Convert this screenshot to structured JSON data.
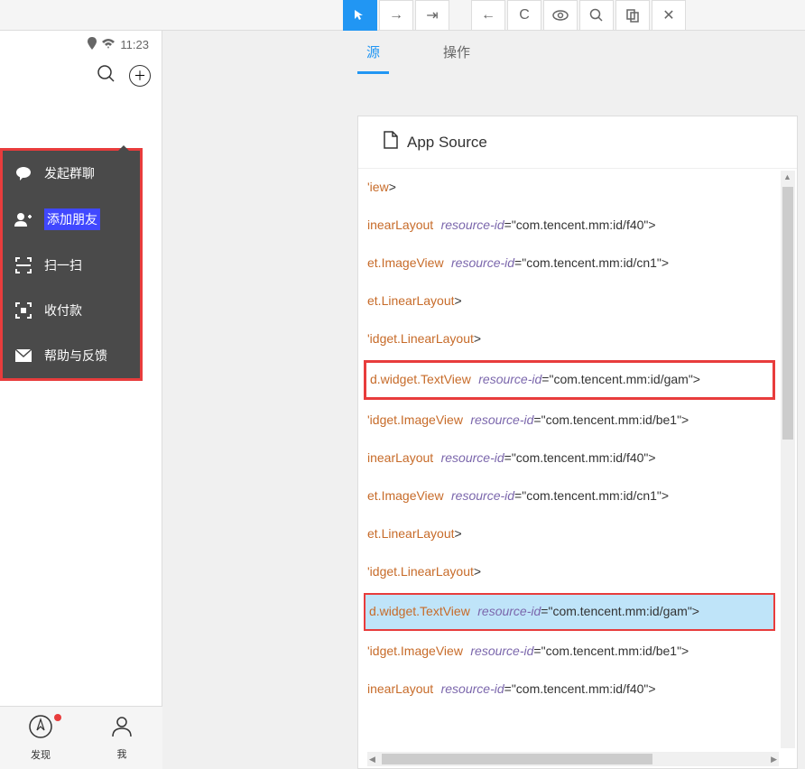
{
  "toolbar": {
    "buttons": [
      "select",
      "swipe-right",
      "swipe-out",
      "back",
      "refresh",
      "eye",
      "search",
      "copy",
      "close"
    ]
  },
  "statusBar": {
    "time": "11:23"
  },
  "dropdown": {
    "items": [
      {
        "icon": "speech",
        "label": "发起群聊"
      },
      {
        "icon": "add-friend",
        "label": "添加朋友",
        "highlighted": true
      },
      {
        "icon": "scan",
        "label": "扫一扫"
      },
      {
        "icon": "pay",
        "label": "收付款"
      },
      {
        "icon": "help",
        "label": "帮助与反馈"
      }
    ]
  },
  "bottomNav": {
    "items": [
      {
        "label": "发现",
        "hasDot": true
      },
      {
        "label": "我"
      }
    ]
  },
  "tabs": {
    "items": [
      {
        "label": "源",
        "active": true
      },
      {
        "label": "操作"
      }
    ]
  },
  "sourcePanel": {
    "title": "App Source",
    "lines": [
      {
        "el": "'iew",
        "attr": null,
        "val": null,
        "close": ">"
      },
      {
        "el": "inearLayout",
        "attr": "resource-id",
        "val": "\"com.tencent.mm:id/f40\"",
        "close": ">"
      },
      {
        "el": "et.ImageView",
        "attr": "resource-id",
        "val": "\"com.tencent.mm:id/cn1\"",
        "close": ">"
      },
      {
        "el": "et.LinearLayout",
        "attr": null,
        "val": null,
        "close": ">"
      },
      {
        "el": "'idget.LinearLayout",
        "attr": null,
        "val": null,
        "close": ">"
      },
      {
        "el": "d.widget.TextView",
        "attr": "resource-id",
        "val": "\"com.tencent.mm:id/gam\"",
        "close": ">",
        "boxed": true
      },
      {
        "el": "'idget.ImageView",
        "attr": "resource-id",
        "val": "\"com.tencent.mm:id/be1\"",
        "close": ">"
      },
      {
        "el": "inearLayout",
        "attr": "resource-id",
        "val": "\"com.tencent.mm:id/f40\"",
        "close": ">"
      },
      {
        "el": "et.ImageView",
        "attr": "resource-id",
        "val": "\"com.tencent.mm:id/cn1\"",
        "close": ">"
      },
      {
        "el": "et.LinearLayout",
        "attr": null,
        "val": null,
        "close": ">"
      },
      {
        "el": "'idget.LinearLayout",
        "attr": null,
        "val": null,
        "close": ">"
      },
      {
        "el": "d.widget.TextView",
        "attr": "resource-id",
        "val": "\"com.tencent.mm:id/gam\"",
        "close": ">",
        "selected": true
      },
      {
        "el": "'idget.ImageView",
        "attr": "resource-id",
        "val": "\"com.tencent.mm:id/be1\"",
        "close": ">"
      },
      {
        "el": "inearLayout",
        "attr": "resource-id",
        "val": "\"com.tencent.mm:id/f40\"",
        "close": ">"
      }
    ]
  }
}
